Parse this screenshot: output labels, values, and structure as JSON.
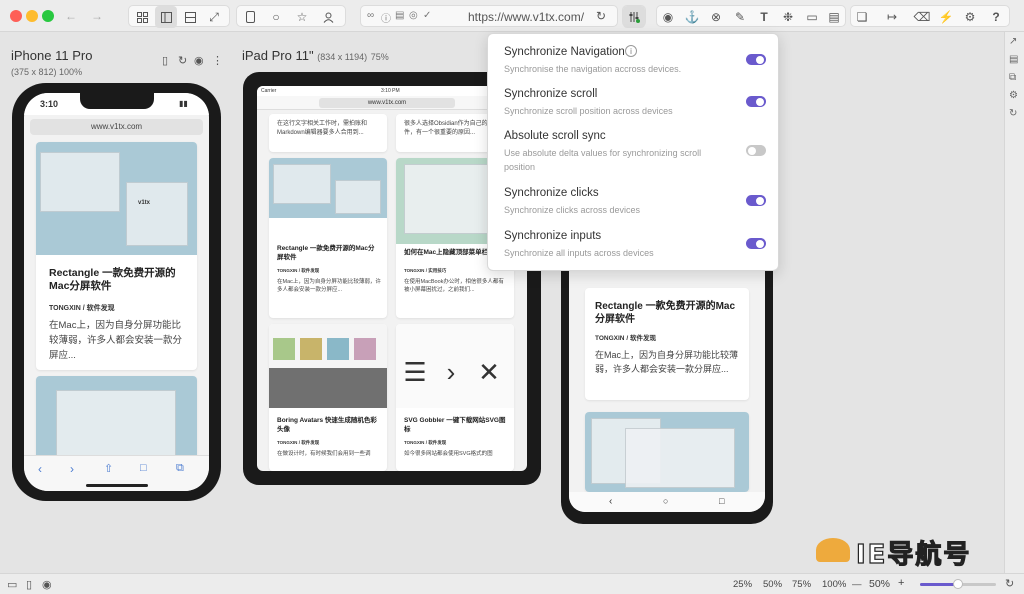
{
  "toolbar": {
    "url": "https://www.v1tx.com/"
  },
  "devices": {
    "iphone": {
      "name": "iPhone 11 Pro",
      "size": "(375 x 812)",
      "zoom": "100%",
      "time": "3:10",
      "address": "www.v1tx.com"
    },
    "ipad": {
      "name": "iPad Pro 11\"",
      "size": "(834 x 1194)",
      "zoom": "75%",
      "time": "3:10 PM",
      "carrier": "Carrier",
      "address": "www.v1tx.com"
    }
  },
  "articles": {
    "a1": {
      "title": "Rectangle 一款免费开源的Mac分屏软件",
      "author": "TONGXIN",
      "sep": "/",
      "category": "软件发现",
      "excerpt": "在Mac上，因为自身分屏功能比较薄弱，许多人都会安装一款分屏应..."
    },
    "a2": {
      "title": "如何在Mac上隐藏顶部菜单栏",
      "author": "TONGXIN",
      "sep": "/",
      "category": "实用技巧",
      "excerpt": "在使用MacBook办公时，相信很多人都有被小屏幕困扰过，之前我们..."
    },
    "a3": {
      "title": "Boring Avatars 快速生成随机色彩头像",
      "author": "TONGXIN",
      "sep": "/",
      "category": "软件发现",
      "excerpt": "在做设计时，有时候我们会用到一些调"
    },
    "a4": {
      "title": "SVG Gobbler 一键下载网站SVG图标",
      "author": "TONGXIN",
      "sep": "/",
      "category": "软件发现",
      "excerpt": "如今很多网站都会使用SVG格式的图"
    },
    "top_left": "在这行文字相关工作时，需拍账和Markdown编辑器要多人合用到...",
    "top_right": "很多人选择Obsidian作为自己的笔记软件，有一个很重要的原因..."
  },
  "popover": {
    "items": [
      {
        "title": "Synchronize Navigation",
        "desc": "Synchronise the navigation accross devices.",
        "on": true
      },
      {
        "title": "Synchronize scroll",
        "desc": "Synchronize scroll position across devices",
        "on": true
      },
      {
        "title": "Absolute scroll sync",
        "desc": "Use absolute delta values for synchronizing scroll position",
        "on": false
      },
      {
        "title": "Synchronize clicks",
        "desc": "Synchronize clicks across devices",
        "on": true
      },
      {
        "title": "Synchronize inputs",
        "desc": "Synchronize all inputs across devices",
        "on": true
      }
    ]
  },
  "status": {
    "zoom_options": [
      "25%",
      "50%",
      "75%",
      "100%"
    ],
    "zoom_minus": "—",
    "zoom_value": "50%",
    "zoom_plus": "+",
    "slider_level": 0.5
  },
  "watermark": {
    "text": "IE导航号"
  },
  "colors": {
    "accent": "#6a5acd",
    "toggle_off": "#c8c8c8"
  }
}
